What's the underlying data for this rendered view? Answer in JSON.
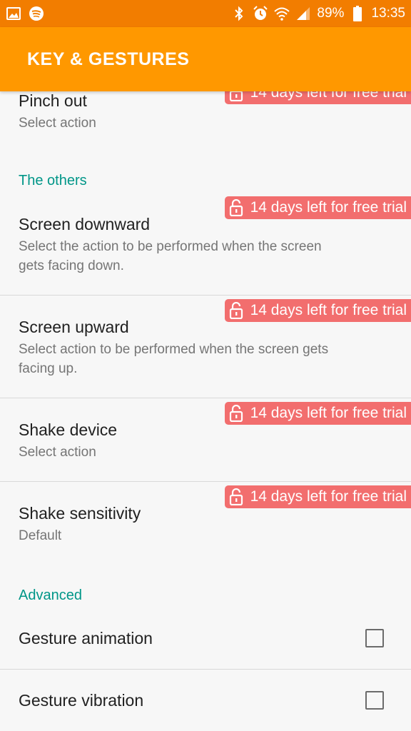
{
  "status_bar": {
    "battery": "89%",
    "time": "13:35",
    "left_icons": [
      "image-icon",
      "spotify-icon"
    ],
    "right_icons": [
      "bluetooth-icon",
      "alarm-icon",
      "wifi-icon",
      "signal-icon",
      "battery-icon"
    ]
  },
  "app_bar": {
    "title": "KEY & GESTURES"
  },
  "trial_badge_text": "14 days left for free trial",
  "items": {
    "pinch_out": {
      "title": "Pinch out",
      "summary": "Select action"
    },
    "screen_downward": {
      "title": "Screen downward",
      "summary_line1": "Select the action to be performed when the screen",
      "summary_line2": "gets facing down."
    },
    "screen_upward": {
      "title": "Screen upward",
      "summary_line1": "Select action to be performed when the screen gets",
      "summary_line2": "facing up."
    },
    "shake_device": {
      "title": "Shake device",
      "summary": "Select action"
    },
    "shake_sensitivity": {
      "title": "Shake sensitivity",
      "summary": "Default"
    },
    "gesture_animation": {
      "title": "Gesture animation",
      "checked": false
    },
    "gesture_vibration": {
      "title": "Gesture vibration",
      "checked": false
    }
  },
  "sections": {
    "others": "The others",
    "advanced": "Advanced"
  },
  "colors": {
    "status_bar": "#f27d00",
    "app_bar": "#ff9800",
    "section_header": "#009688",
    "trial_badge": "#f26e6e"
  }
}
